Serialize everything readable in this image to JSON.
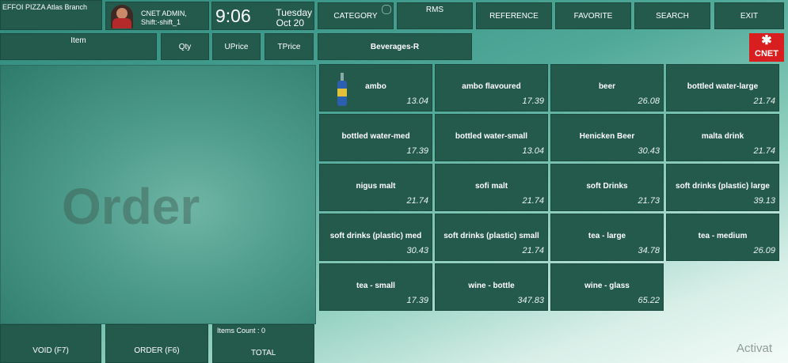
{
  "header": {
    "branch": "EFFOI PIZZA Atlas Branch",
    "user_line1": "CNET ADMIN,",
    "user_line2": "Shift:-shift_1",
    "time": "9:06",
    "day": "Tuesday",
    "date": "Oct 20"
  },
  "topnav": {
    "category": "CATEGORY",
    "rms": "RMS",
    "reference": "REFERENCE",
    "favorite": "FAVORITE",
    "search": "SEARCH",
    "exit": "EXIT"
  },
  "columns": {
    "item": "Item",
    "qty": "Qty",
    "uprice": "UPrice",
    "tprice": "TPrice"
  },
  "category_title": "Beverages-R",
  "logo_text": "CNET",
  "order_watermark": "Order",
  "bottom": {
    "void": "VOID (F7)",
    "order": "ORDER (F6)",
    "items_count": "Items Count : 0",
    "total": "TOTAL"
  },
  "items": [
    {
      "name": "ambo",
      "price": "13.04"
    },
    {
      "name": "ambo flavoured",
      "price": "17.39"
    },
    {
      "name": "beer",
      "price": "26.08"
    },
    {
      "name": "bottled water-large",
      "price": "21.74"
    },
    {
      "name": "bottled water-med",
      "price": "17.39"
    },
    {
      "name": "bottled water-small",
      "price": "13.04"
    },
    {
      "name": "Henicken Beer",
      "price": "30.43"
    },
    {
      "name": "malta drink",
      "price": "21.74"
    },
    {
      "name": "nigus malt",
      "price": "21.74"
    },
    {
      "name": "sofi malt",
      "price": "21.74"
    },
    {
      "name": "soft Drinks",
      "price": "21.73"
    },
    {
      "name": "soft drinks (plastic) large",
      "price": "39.13"
    },
    {
      "name": "soft drinks (plastic) med",
      "price": "30.43"
    },
    {
      "name": "soft drinks (plastic) small",
      "price": "21.74"
    },
    {
      "name": "tea - large",
      "price": "34.78"
    },
    {
      "name": "tea - medium",
      "price": "26.09"
    },
    {
      "name": "tea - small",
      "price": "17.39"
    },
    {
      "name": "wine - bottle",
      "price": "347.83"
    },
    {
      "name": "wine - glass",
      "price": "65.22"
    }
  ],
  "watermark_text": "Activat"
}
